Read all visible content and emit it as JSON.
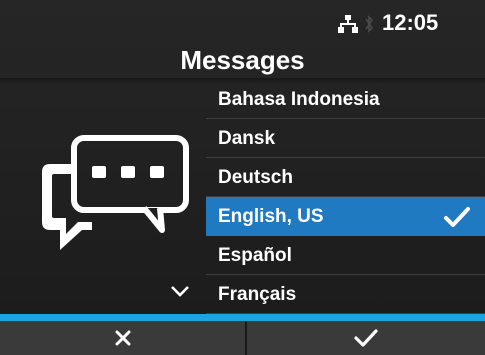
{
  "status_bar": {
    "time": "12:05",
    "icons": [
      "network-icon",
      "bluetooth-icon"
    ]
  },
  "screen": {
    "title": "Messages"
  },
  "languages": {
    "items": [
      {
        "label": "Bahasa Indonesia",
        "selected": false
      },
      {
        "label": "Dansk",
        "selected": false
      },
      {
        "label": "Deutsch",
        "selected": false
      },
      {
        "label": "English, US",
        "selected": true
      },
      {
        "label": "Español",
        "selected": false
      },
      {
        "label": "Français",
        "selected": false
      }
    ]
  },
  "footer": {
    "cancel_icon": "close-icon",
    "confirm_icon": "check-icon"
  },
  "colors": {
    "accent": "#1aa7e0",
    "selection": "#1f7ac2",
    "background": "#1f1f1f",
    "footer": "#3a3a3a"
  }
}
